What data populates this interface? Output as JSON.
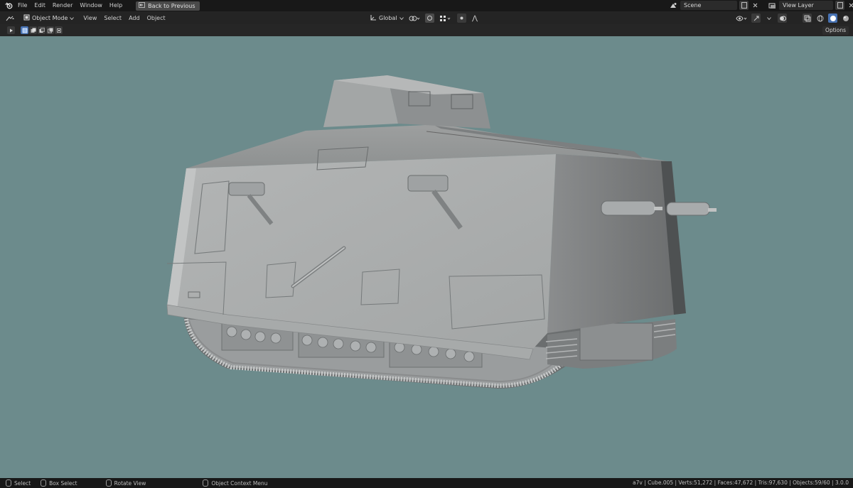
{
  "topbar": {
    "menus": [
      "File",
      "Edit",
      "Render",
      "Window",
      "Help"
    ],
    "back_button": "Back to Previous",
    "scene": "Scene",
    "view_layer": "View Layer"
  },
  "header": {
    "mode": "Object Mode",
    "menus": [
      "View",
      "Select",
      "Add",
      "Object"
    ],
    "orientation": "Global"
  },
  "toolheader": {
    "options": "Options"
  },
  "statusbar": {
    "hint_select": "Select",
    "hint_box_select": "Box Select",
    "hint_rotate": "Rotate View",
    "hint_context": "Object Context Menu",
    "stats": "a7v | Cube.005 | Verts:51,272 | Faces:47,672 | Tris:97,630 | Objects:59/60 | 3.0.0"
  },
  "colors": {
    "viewport_bg": "#6c8b8c",
    "ui_dark": "#181818",
    "ui_header": "#242424",
    "accent": "#4772b3"
  }
}
